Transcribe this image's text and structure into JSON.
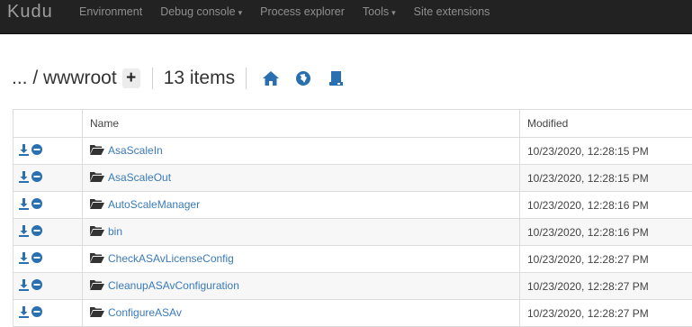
{
  "navbar": {
    "brand": "Kudu",
    "items": [
      {
        "label": "Environment",
        "dropdown": false
      },
      {
        "label": "Debug console",
        "dropdown": true
      },
      {
        "label": "Process explorer",
        "dropdown": false
      },
      {
        "label": "Tools",
        "dropdown": true
      },
      {
        "label": "Site extensions",
        "dropdown": false
      }
    ]
  },
  "pathbar": {
    "path": "... / wwwroot",
    "plus": "+",
    "item_count": "13 items",
    "icons": [
      "home-icon",
      "globe-icon",
      "drive-icon"
    ],
    "icon_color": "#2a6fb0"
  },
  "table": {
    "columns": [
      "",
      "Name",
      "Modified"
    ],
    "rows": [
      {
        "name": "AsaScaleIn",
        "modified": "10/23/2020, 12:28:15 PM"
      },
      {
        "name": "AsaScaleOut",
        "modified": "10/23/2020, 12:28:15 PM"
      },
      {
        "name": "AutoScaleManager",
        "modified": "10/23/2020, 12:28:16 PM"
      },
      {
        "name": "bin",
        "modified": "10/23/2020, 12:28:16 PM"
      },
      {
        "name": "CheckASAvLicenseConfig",
        "modified": "10/23/2020, 12:28:27 PM"
      },
      {
        "name": "CleanupASAvConfiguration",
        "modified": "10/23/2020, 12:28:27 PM"
      },
      {
        "name": "ConfigureASAv",
        "modified": "10/23/2020, 12:28:27 PM"
      }
    ]
  }
}
